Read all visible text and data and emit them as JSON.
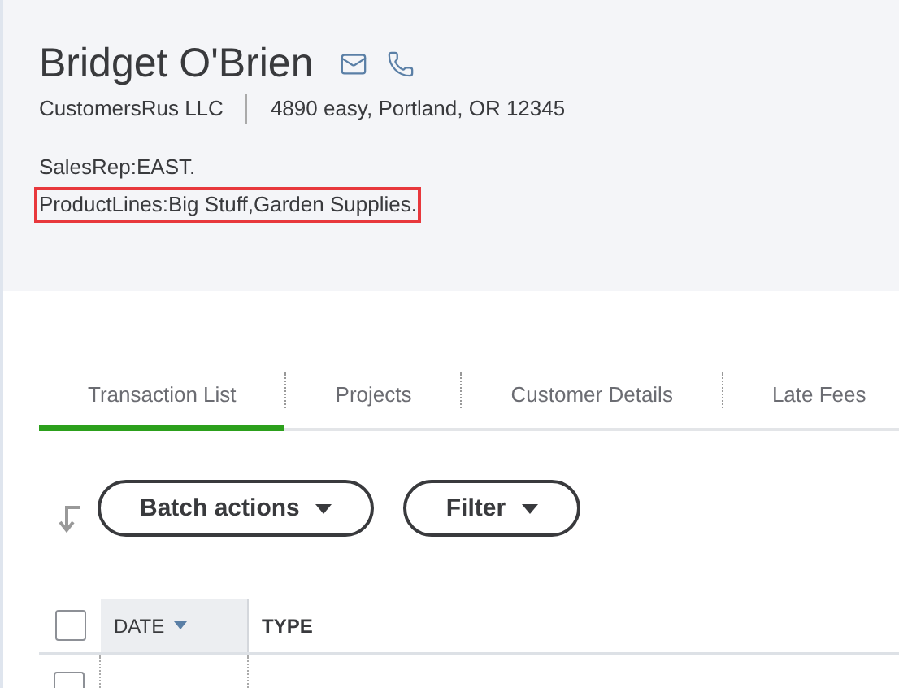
{
  "customer": {
    "name": "Bridget O'Brien",
    "company": "CustomersRus LLC",
    "address": "4890 easy, Portland, OR 12345"
  },
  "notes": [
    {
      "text": "SalesRep:EAST.",
      "highlighted": false
    },
    {
      "text": "ProductLines:Big Stuff,Garden Supplies.",
      "highlighted": true
    }
  ],
  "tabs": [
    {
      "label": "Transaction List",
      "selected": true
    },
    {
      "label": "Projects",
      "selected": false
    },
    {
      "label": "Customer Details",
      "selected": false
    },
    {
      "label": "Late Fees",
      "selected": false
    }
  ],
  "actions": [
    {
      "label": "Batch actions"
    },
    {
      "label": "Filter"
    }
  ],
  "table": {
    "columns": [
      {
        "label": "DATE",
        "sorted": true
      },
      {
        "label": "TYPE",
        "sorted": false
      }
    ],
    "select_all": {
      "checked": false
    },
    "rows": [
      {
        "checked": false
      }
    ]
  }
}
